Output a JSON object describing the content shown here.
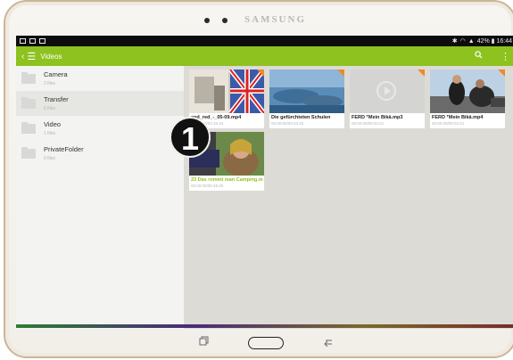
{
  "device": {
    "brand": "SAMSUNG"
  },
  "statusbar": {
    "right_text": "42% ▮ 16:44"
  },
  "appbar": {
    "back_icon": "back-arrow-icon",
    "menu_icon": "hamburger-menu-icon",
    "title": "Videos",
    "search_icon": "search-icon",
    "overflow_icon": "overflow-menu-icon"
  },
  "folders": [
    {
      "name": "Camera",
      "count": "2 files"
    },
    {
      "name": "Transfer",
      "count": "5 files"
    },
    {
      "name": "Video",
      "count": "1 files"
    },
    {
      "name": "PrivateFolder",
      "count": "0 files"
    }
  ],
  "videos": [
    {
      "title": "and_red_-_05-09.mp4",
      "meta": "00:00:00/00:16:44"
    },
    {
      "title": "Die gefürchteten Schulen",
      "meta": "00:00:00/00:43:20"
    },
    {
      "title": "FERD ᵀMein Bikä.mp3",
      "meta": "00:00:00/00:04:21"
    },
    {
      "title": "FERD ᵀMein Bikä.mp4",
      "meta": "00:00:00/00:04:21"
    },
    {
      "title": "23 Das rommt man Camping.m",
      "meta": "00:00:00/00:48:20"
    }
  ],
  "callout": {
    "label": "1"
  },
  "nav": {
    "recent_icon": "recent-apps-icon",
    "home_icon": "home-button-icon",
    "back_icon": "back-icon"
  }
}
